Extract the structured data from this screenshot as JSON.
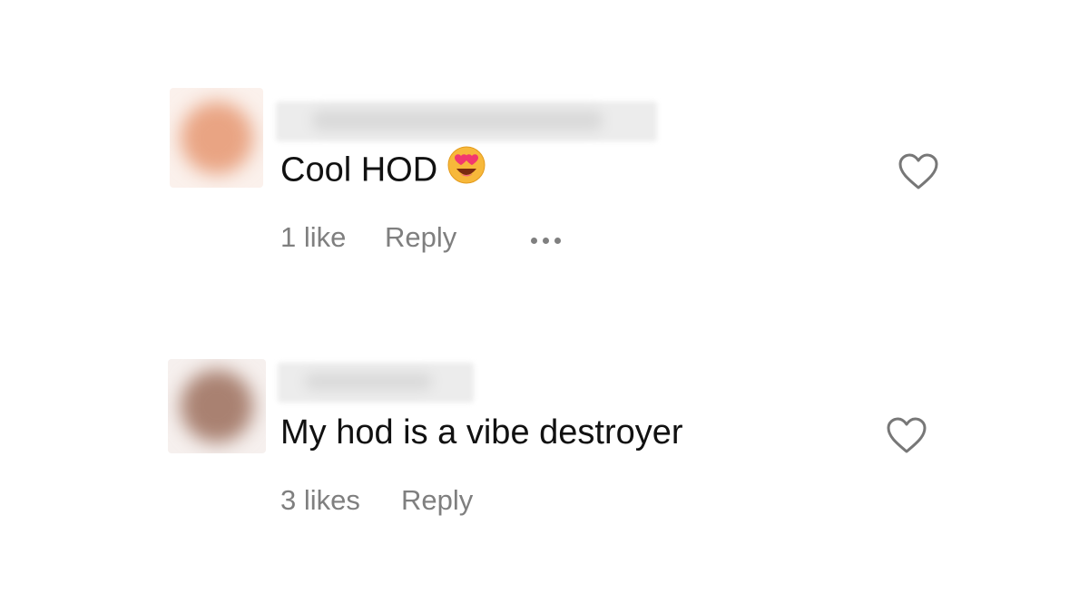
{
  "comments": [
    {
      "text": "Cool HOD",
      "emoji_icon": "heart-eyes-emoji-icon",
      "likes_label": "1 like",
      "reply_label": "Reply",
      "avatar_color": "#e8a07c"
    },
    {
      "text": "My hod is a vibe destroyer",
      "likes_label": "3 likes",
      "reply_label": "Reply",
      "avatar_color": "#a07a68"
    }
  ],
  "colors": {
    "meta_text": "#7f7f7f",
    "comment_text": "#111111",
    "heart_outline": "#777777"
  }
}
